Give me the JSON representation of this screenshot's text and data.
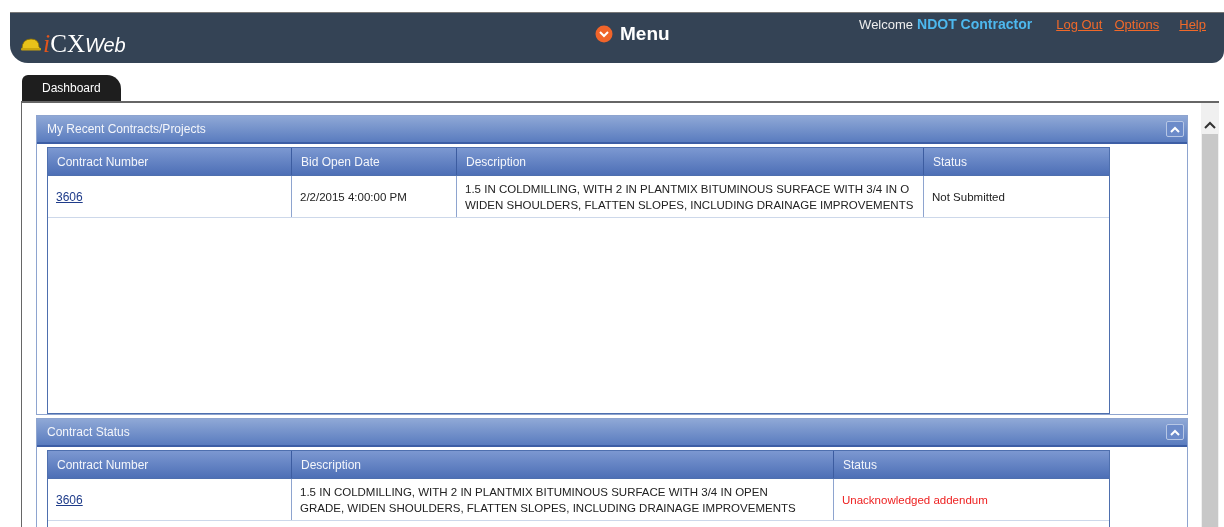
{
  "header": {
    "logo_prefix": "i",
    "logo_main": "CX",
    "logo_suffix": "Web",
    "menu": "Menu",
    "welcome": "Welcome",
    "user": "NDOT Contractor",
    "links": [
      "Log Out",
      "Options",
      "Help"
    ]
  },
  "tabs": [
    {
      "label": "Dashboard",
      "selected": true
    }
  ],
  "panels": [
    {
      "title": "My Recent Contracts/Projects",
      "expanded": true,
      "columns": [
        "Contract Number",
        "Bid Open Date",
        "Description",
        "Status"
      ],
      "rows": [
        {
          "cells": [
            {
              "kind": "link",
              "lines": [
                "3606"
              ]
            },
            {
              "kind": "text",
              "lines": [
                "2/2/2015 4:00:00 PM"
              ]
            },
            {
              "kind": "text",
              "lines": [
                "1.5 IN COLDMILLING, WITH 2 IN PLANTMIX BITUMINOUS SURFACE WITH 3/4 IN O",
                "WIDEN SHOULDERS, FLATTEN SLOPES, INCLUDING DRAINAGE IMPROVEMENTS"
              ]
            },
            {
              "kind": "text",
              "lines": [
                "Not Submitted"
              ]
            }
          ]
        }
      ]
    },
    {
      "title": "Contract Status",
      "expanded": true,
      "columns": [
        "Contract Number",
        "Description",
        "Status"
      ],
      "rows": [
        {
          "cells": [
            {
              "kind": "link",
              "lines": [
                "3606"
              ]
            },
            {
              "kind": "text",
              "lines": [
                "1.5 IN COLDMILLING, WITH 2 IN PLANTMIX BITUMINOUS SURFACE WITH 3/4 IN OPEN",
                "GRADE, WIDEN SHOULDERS, FLATTEN SLOPES, INCLUDING DRAINAGE IMPROVEMENTS"
              ]
            },
            {
              "kind": "alert",
              "lines": [
                "Unacknowledged addendum"
              ]
            }
          ]
        }
      ]
    }
  ]
}
